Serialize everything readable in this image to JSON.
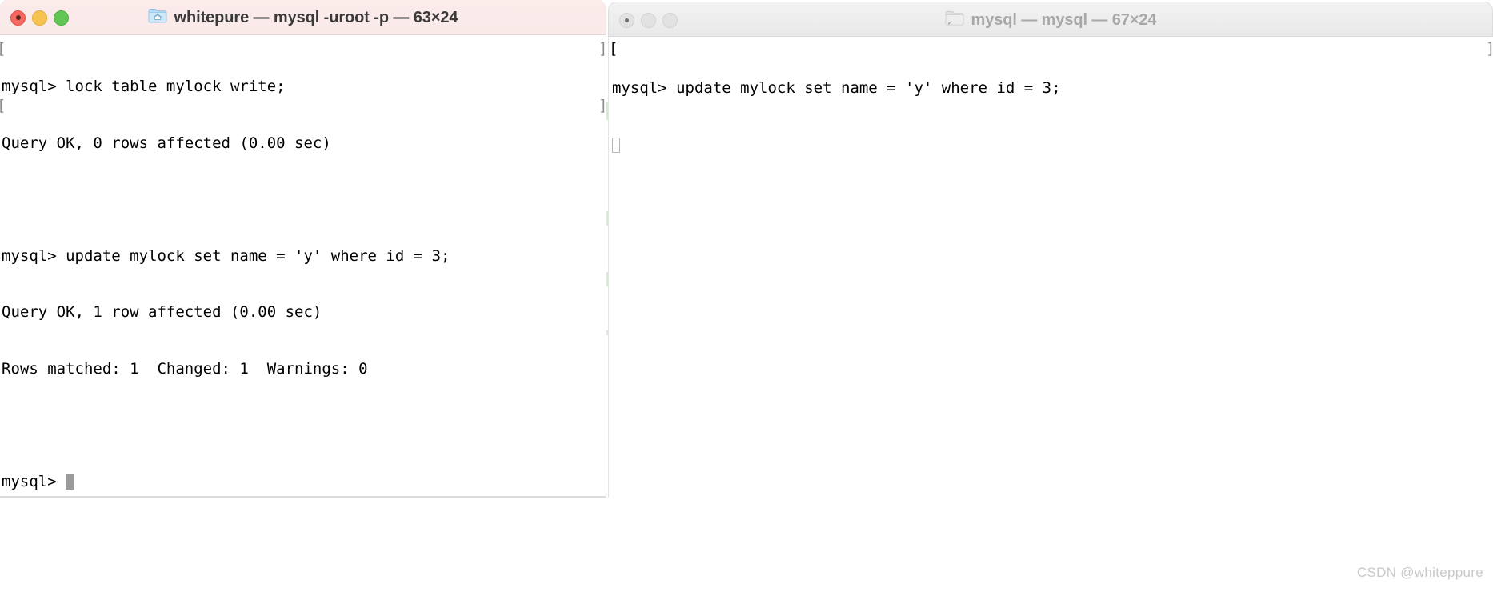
{
  "desktop": {
    "background_color": "#ffffff",
    "watermark": "CSDN @whiteppure"
  },
  "windows": [
    {
      "id": "left-terminal",
      "active": true,
      "titlebar": {
        "title": "whitepure — mysql -uroot -p — 63×24",
        "icon": "folder-icon",
        "background_color": "#fbeceb",
        "traffic_lights": [
          {
            "name": "close",
            "label": "Close",
            "color": "#f4685f"
          },
          {
            "name": "minimize",
            "label": "Minimize",
            "color": "#f6c350"
          },
          {
            "name": "maximize",
            "label": "Maximize",
            "color": "#62c654"
          }
        ]
      },
      "terminal": {
        "columns": 63,
        "rows": 24,
        "background_color": "#ffffff",
        "foreground_color": "#000000",
        "lines": [
          "mysql> lock table mylock write;",
          "Query OK, 0 rows affected (0.00 sec)",
          "",
          "mysql> update mylock set name = 'y' where id = 3;",
          "Query OK, 1 row affected (0.00 sec)",
          "Rows matched: 1  Changed: 1  Warnings: 0",
          ""
        ],
        "prompt": "mysql> ",
        "cursor": {
          "style": "block-filled",
          "color": "#9a9a9a"
        }
      }
    },
    {
      "id": "right-terminal",
      "active": false,
      "titlebar": {
        "title": "mysql — mysql — 67×24",
        "icon": "folder-icon",
        "background_color": "#f2f2f2",
        "traffic_lights": [
          {
            "name": "close",
            "label": "Close",
            "color": "#e2e2e2"
          },
          {
            "name": "minimize",
            "label": "Minimize",
            "color": "#e2e2e2"
          },
          {
            "name": "maximize",
            "label": "Maximize",
            "color": "#e2e2e2"
          }
        ]
      },
      "terminal": {
        "columns": 67,
        "rows": 24,
        "background_color": "#ffffff",
        "foreground_color": "#000000",
        "lines": [
          "mysql> update mylock set name = 'y' where id = 3;"
        ],
        "prompt": "",
        "cursor": {
          "style": "block-hollow",
          "color": "#b5b5b5"
        },
        "status": "blocked-waiting-for-lock"
      }
    }
  ],
  "artifacts": {
    "left_edge_bracket_rows": [
      "[",
      "",
      "",
      "[",
      "",
      "",
      ""
    ],
    "divider_bracket_rows": [
      "]",
      "",
      "",
      "]"
    ],
    "right_edge_bracket": "]"
  }
}
